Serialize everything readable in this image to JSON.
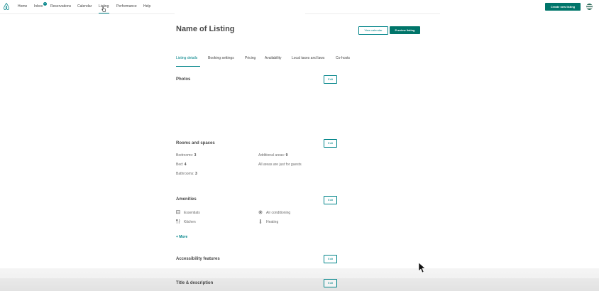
{
  "nav": {
    "items": [
      "Home",
      "Inbox",
      "Reservations",
      "Calendar",
      "Listing",
      "Performance",
      "Help"
    ],
    "inbox_badge": "5",
    "active": "Listing",
    "create_label": "Create new listing"
  },
  "listing": {
    "title": "Name of Listing",
    "view_calendar": "View calendar",
    "preview": "Preview listing"
  },
  "tabs": [
    "Listing details",
    "Booking settings",
    "Pricing",
    "Availability",
    "Local taxes and laws",
    "Co-hosts"
  ],
  "sections": {
    "photos": "Photos",
    "rooms": "Rooms and spaces",
    "amenities": "Amenities",
    "accessibility": "Accessibility features",
    "title_desc": "Title & description",
    "edit": "Edit"
  },
  "rooms": {
    "bedrooms_label": "Bedrooms:",
    "bedrooms": "3",
    "beds_label": "Bed:",
    "beds": "4",
    "bathrooms_label": "Bathrooms:",
    "bathrooms": "3",
    "additional_label": "Additional areas:",
    "additional": "9",
    "guest_areas": "All areas are just for guests"
  },
  "amenities": {
    "items": [
      {
        "label": "Essentials",
        "icon": "essentials-icon"
      },
      {
        "label": "Air conditioning",
        "icon": "snowflake-icon"
      },
      {
        "label": "Kitchen",
        "icon": "utensils-icon"
      },
      {
        "label": "Heating",
        "icon": "thermometer-icon"
      }
    ],
    "more": "+ More"
  },
  "colors": {
    "accent": "#008489",
    "primary_button": "#00756a",
    "text": "#484848"
  }
}
